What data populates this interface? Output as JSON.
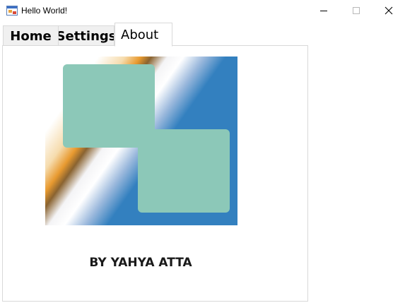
{
  "window": {
    "title": "Hello World!",
    "app_icon": "windows-forms-icon",
    "controls": {
      "minimize_icon": "minimize-icon",
      "maximize_icon": "maximize-icon",
      "close_icon": "close-icon"
    }
  },
  "tabs": [
    {
      "label": "Home",
      "selected": false
    },
    {
      "label": "Settings",
      "selected": false
    },
    {
      "label": "About",
      "selected": true
    }
  ],
  "about": {
    "logo_icon": "app-logo",
    "author": "BY YAHYA ATTA"
  },
  "colors": {
    "logo_blue": "#3380bf",
    "logo_orange": "#e89a30",
    "logo_mint": "#8cc8b8",
    "tab_background": "#f0f0f0",
    "border": "#d9d9d9"
  }
}
